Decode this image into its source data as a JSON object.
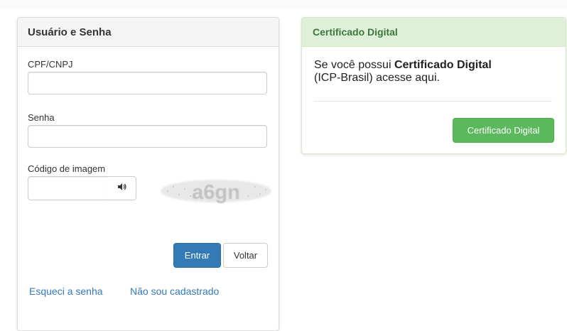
{
  "login": {
    "title": "Usuário e Senha",
    "cpf_label": "CPF/CNPJ",
    "cpf_value": "",
    "senha_label": "Senha",
    "senha_value": "",
    "codigo_label": "Código de imagem",
    "codigo_value": "",
    "captcha_text": "a6gn",
    "entrar_label": "Entrar",
    "voltar_label": "Voltar",
    "forgot_link": "Esqueci a senha",
    "register_link": "Não sou cadastrado"
  },
  "certificado": {
    "header": "Certificado Digital",
    "text_prefix": "Se você possui ",
    "text_bold": "Certificado Digital",
    "text_suffix": "(ICP-Brasil) acesse aqui.",
    "button_label": "Certificado Digital"
  },
  "colors": {
    "primary": "#337ab7",
    "success": "#5cb85c",
    "success_header_bg": "#dff0d8",
    "success_header_text": "#3c763d"
  },
  "icons": {
    "audio": "volume-icon"
  }
}
